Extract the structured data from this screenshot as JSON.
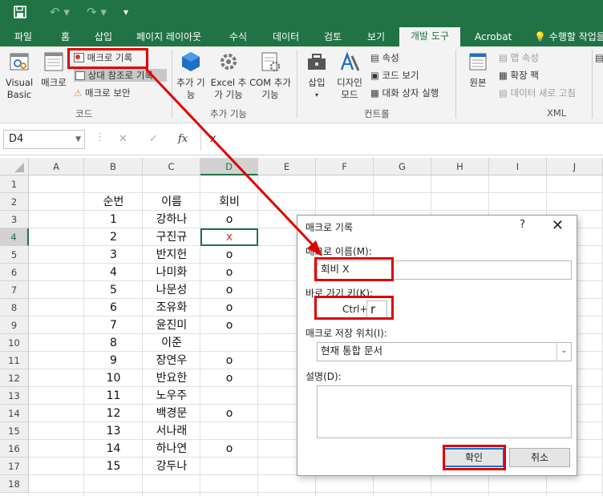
{
  "quick_access": {
    "save_icon": "save-icon",
    "undo_icon": "undo-icon",
    "redo_icon": "redo-icon",
    "customize_icon": "customize-icon"
  },
  "tabs": [
    {
      "label": "파일",
      "active": false
    },
    {
      "label": "홈",
      "active": false
    },
    {
      "label": "삽입",
      "active": false
    },
    {
      "label": "페이지 레이아웃",
      "active": false
    },
    {
      "label": "수식",
      "active": false
    },
    {
      "label": "데이터",
      "active": false
    },
    {
      "label": "검토",
      "active": false
    },
    {
      "label": "보기",
      "active": false
    },
    {
      "label": "개발 도구",
      "active": true
    },
    {
      "label": "Acrobat",
      "active": false
    },
    {
      "label": "수행할 작업을",
      "active": false
    }
  ],
  "ribbon": {
    "code": {
      "visual_basic": "Visual Basic",
      "macros": "매크로",
      "record_macro": "매크로 기록",
      "relative_ref": "상대 참조로 기록",
      "macro_security": "매크로 보안",
      "group": "코드"
    },
    "addins": {
      "addins": "추가 기능",
      "excel_addins": "Excel 추가 기능",
      "com_addins": "COM 추가 기능",
      "group": "추가 기능"
    },
    "controls": {
      "insert": "삽입",
      "design_mode": "디자인 모드",
      "properties": "속성",
      "view_code": "코드 보기",
      "run_dialog": "대화 상자 실행",
      "group": "컨트롤"
    },
    "xml": {
      "source": "원본",
      "map_properties": "맵 속성",
      "expansion_packs": "확장 팩",
      "refresh_data": "데이터 새로 고침",
      "group": "XML"
    }
  },
  "formula_bar": {
    "name_box": "D4",
    "cancel": "✕",
    "enter": "✓",
    "fx": "fx",
    "value": "x"
  },
  "columns": [
    "A",
    "B",
    "C",
    "D",
    "E",
    "F",
    "G",
    "H",
    "I",
    "J"
  ],
  "selected_column": "D",
  "rows": [
    "1",
    "2",
    "3",
    "4",
    "5",
    "6",
    "7",
    "8",
    "9",
    "10",
    "11",
    "12",
    "13",
    "14",
    "15",
    "16",
    "17",
    "18"
  ],
  "selected_row": "4",
  "headers": {
    "seq": "순번",
    "name": "이름",
    "fee": "회비"
  },
  "table": [
    {
      "seq": "1",
      "name": "강하나",
      "fee": "o"
    },
    {
      "seq": "2",
      "name": "구진규",
      "fee": "x"
    },
    {
      "seq": "3",
      "name": "반지헌",
      "fee": "o"
    },
    {
      "seq": "4",
      "name": "나미화",
      "fee": "o"
    },
    {
      "seq": "5",
      "name": "나문성",
      "fee": "o"
    },
    {
      "seq": "6",
      "name": "조유화",
      "fee": "o"
    },
    {
      "seq": "7",
      "name": "윤진미",
      "fee": "o"
    },
    {
      "seq": "8",
      "name": "이준",
      "fee": ""
    },
    {
      "seq": "9",
      "name": "장연우",
      "fee": "o"
    },
    {
      "seq": "10",
      "name": "반요한",
      "fee": "o"
    },
    {
      "seq": "11",
      "name": "노우주",
      "fee": ""
    },
    {
      "seq": "12",
      "name": "백경문",
      "fee": "o"
    },
    {
      "seq": "13",
      "name": "서나래",
      "fee": ""
    },
    {
      "seq": "14",
      "name": "하나연",
      "fee": "o"
    },
    {
      "seq": "15",
      "name": "강두나",
      "fee": ""
    }
  ],
  "dialog": {
    "title": "매크로 기록",
    "help": "?",
    "close": "✕",
    "macro_name_label": "매크로 이름(M):",
    "macro_name_value": "회비 X",
    "shortcut_label": "바로 가기 키(K):",
    "shortcut_prefix": "Ctrl+",
    "shortcut_value": "r",
    "store_label": "매크로 저장 위치(I):",
    "store_value": "현재 통합 문서",
    "description_label": "설명(D):",
    "ok": "확인",
    "cancel": "취소"
  },
  "colors": {
    "excel_green": "#217346",
    "highlight_red": "#e00000",
    "dialog_default": "#0078d7"
  }
}
